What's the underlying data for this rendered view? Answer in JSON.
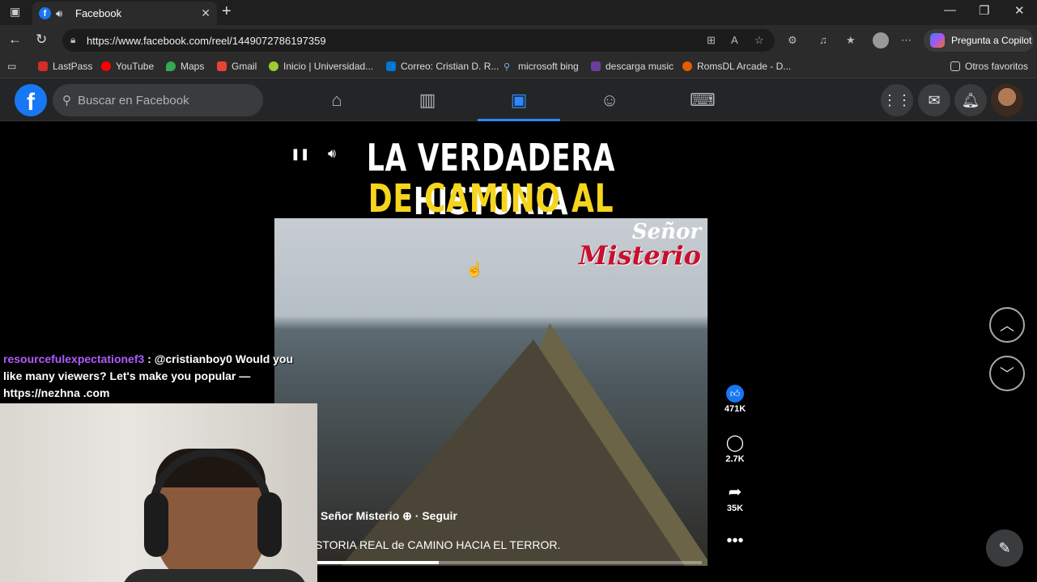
{
  "browser": {
    "tab_title": "Facebook",
    "favicon_letter": "f",
    "url": "https://www.facebook.com/reel/1449072786197359",
    "copilot_label": "Pregunta a Copilot",
    "bookmarks": [
      "LastPass",
      "YouTube",
      "Maps",
      "Gmail",
      "Inicio | Universidad...",
      "Correo: Cristian D. R...",
      "microsoft bing",
      "descarga music",
      "RomsDL Arcade - D..."
    ],
    "other_favorites": "Otros favoritos"
  },
  "facebook": {
    "logo_letter": "f",
    "search_placeholder": "Buscar en Facebook"
  },
  "reel": {
    "title_line1": "LA VERDADERA HISTORIA",
    "title_line2": "DE CAMINO AL TERROR",
    "brand_line1": "Señor",
    "brand_line2": "Misterio",
    "author": "Señor Misterio",
    "follow_text": "· Seguir",
    "caption": "STORIA REAL de CAMINO HACIA EL TERROR.",
    "progress": 0.32,
    "likes": "471K",
    "comments": "2.7K",
    "shares": "35K"
  },
  "chat": {
    "user": "resourcefulexpectationef3",
    "message": " : @cristianboy0 Would you like many viewers? Let's make you popular — https://nezhna .com"
  },
  "colors": {
    "fb_blue": "#1877f2",
    "title_yellow": "#f5d51d",
    "chat_user": "#b05cff"
  }
}
